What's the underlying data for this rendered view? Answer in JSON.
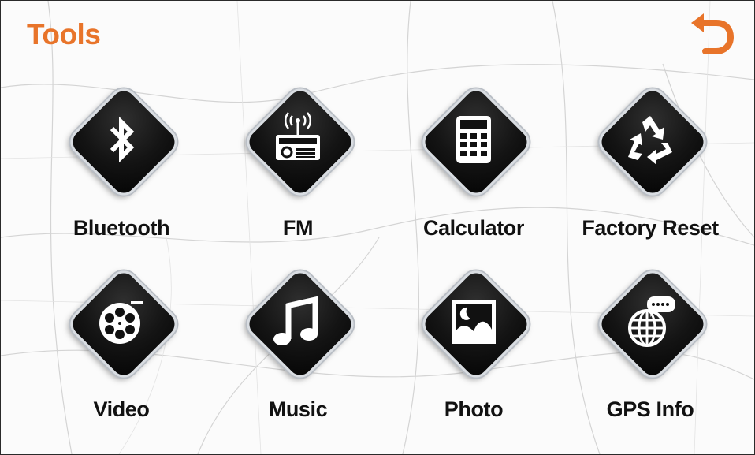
{
  "header": {
    "title": "Tools",
    "back_icon": "undo-arrow-icon",
    "accent_color": "#e8742a"
  },
  "tools": [
    {
      "label": "Bluetooth",
      "icon": "bluetooth-icon"
    },
    {
      "label": "FM",
      "icon": "radio-icon"
    },
    {
      "label": "Calculator",
      "icon": "calculator-icon"
    },
    {
      "label": "Factory Reset",
      "icon": "recycle-icon"
    },
    {
      "label": "Video",
      "icon": "film-reel-icon"
    },
    {
      "label": "Music",
      "icon": "music-note-icon"
    },
    {
      "label": "Photo",
      "icon": "image-icon"
    },
    {
      "label": "GPS Info",
      "icon": "globe-chat-icon"
    }
  ]
}
